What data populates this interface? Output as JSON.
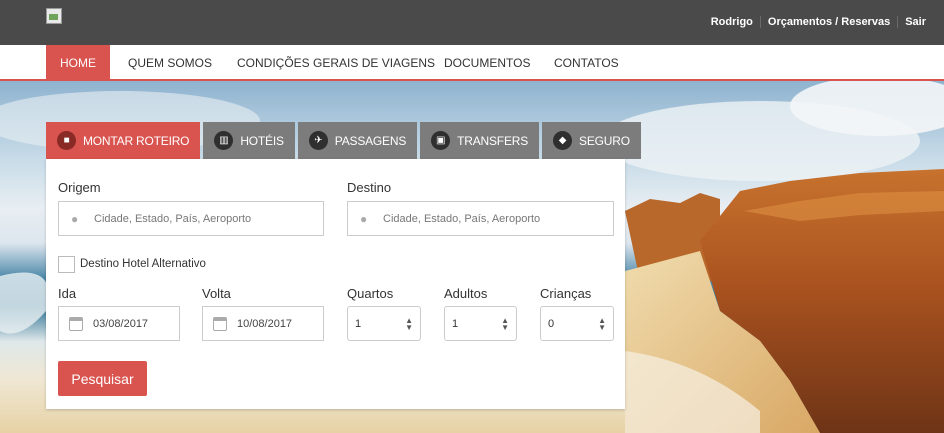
{
  "header": {
    "links": [
      "Rodrigo",
      "Orçamentos / Reservas",
      "Sair"
    ]
  },
  "nav": {
    "items": [
      "HOME",
      "QUEM SOMOS",
      "CONDIÇÕES GERAIS DE VIAGENS",
      "DOCUMENTOS",
      "CONTATOS"
    ],
    "active": "HOME"
  },
  "search": {
    "tabs": [
      {
        "label": "MONTAR ROTEIRO",
        "icon": "briefcase-icon"
      },
      {
        "label": "HOTÉIS",
        "icon": "building-icon"
      },
      {
        "label": "PASSAGENS",
        "icon": "plane-icon"
      },
      {
        "label": "TRANSFERS",
        "icon": "bus-icon"
      },
      {
        "label": "SEGURO",
        "icon": "shield-icon"
      }
    ],
    "active_tab": "MONTAR ROTEIRO",
    "origin": {
      "label": "Origem",
      "placeholder": "Cidade, Estado, País, Aeroporto"
    },
    "destination": {
      "label": "Destino",
      "placeholder": "Cidade, Estado, País, Aeroporto"
    },
    "alt_hotel": {
      "label": "Destino Hotel Alternativo",
      "checked": false
    },
    "ida": {
      "label": "Ida",
      "value": "03/08/2017"
    },
    "volta": {
      "label": "Volta",
      "value": "10/08/2017"
    },
    "quartos": {
      "label": "Quartos",
      "value": "1"
    },
    "adultos": {
      "label": "Adultos",
      "value": "1"
    },
    "criancas": {
      "label": "Crianças",
      "value": "0"
    },
    "submit": "Pesquisar"
  },
  "colors": {
    "accent": "#d9534f",
    "topbar": "#4a4a4a",
    "tab_inactive": "#7c7c7c"
  }
}
